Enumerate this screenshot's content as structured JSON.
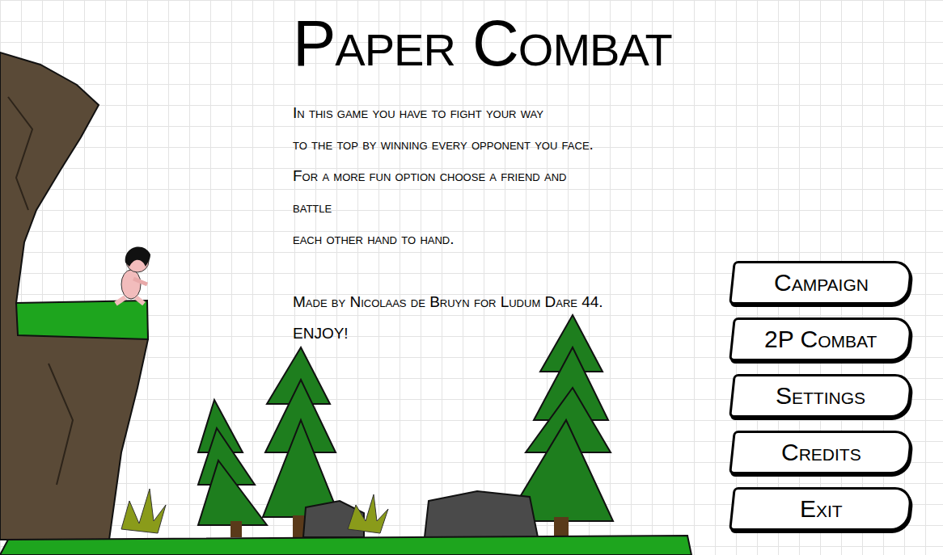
{
  "title": "Paper Combat",
  "description": [
    "In this game you have to fight your way",
    "to the top by winning every opponent you face.",
    "For a more fun option choose a friend and",
    "battle",
    "each other hand to hand."
  ],
  "credits": [
    "Made by Nicolaas de Bruyn for Ludum Dare 44.",
    "ENJOY!"
  ],
  "buttons": [
    {
      "label": "Campaign"
    },
    {
      "label": "2P Combat"
    },
    {
      "label": "Settings"
    },
    {
      "label": "Credits"
    },
    {
      "label": "Exit"
    }
  ]
}
